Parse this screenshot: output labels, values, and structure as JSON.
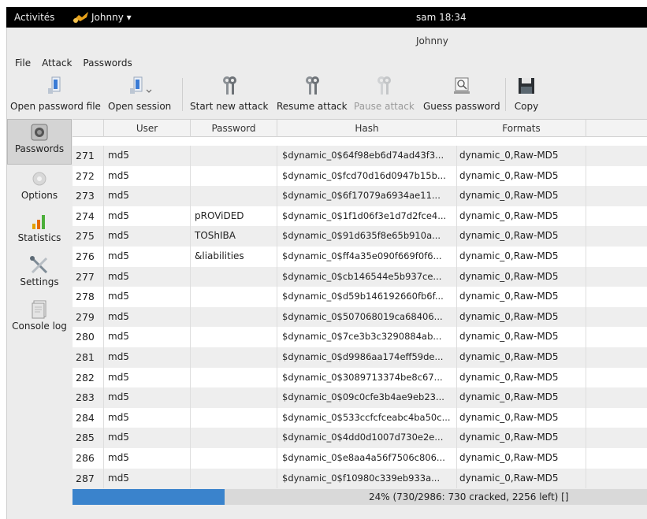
{
  "topbar": {
    "activities": "Activités",
    "user": "Johnny ▾",
    "clock": "sam 18:34"
  },
  "window": {
    "title": "Johnny"
  },
  "menu": {
    "file": "File",
    "attack": "Attack",
    "passwords": "Passwords"
  },
  "toolbar": {
    "open_password_file": "Open password file",
    "open_session": "Open session",
    "start_new_attack": "Start new attack",
    "resume_attack": "Resume attack",
    "pause_attack": "Pause attack",
    "guess_password": "Guess password",
    "copy": "Copy"
  },
  "sidebar": {
    "passwords": "Passwords",
    "options": "Options",
    "statistics": "Statistics",
    "settings": "Settings",
    "console_log": "Console log"
  },
  "table": {
    "headers": {
      "user": "User",
      "password": "Password",
      "hash": "Hash",
      "formats": "Formats"
    },
    "rows": [
      {
        "num": "271",
        "user": "md5",
        "password": "",
        "hash": "$dynamic_0$64f98eb6d74ad43f3...",
        "format": "dynamic_0,Raw-MD5"
      },
      {
        "num": "272",
        "user": "md5",
        "password": "",
        "hash": "$dynamic_0$fcd70d16d0947b15b...",
        "format": "dynamic_0,Raw-MD5"
      },
      {
        "num": "273",
        "user": "md5",
        "password": "",
        "hash": "$dynamic_0$6f17079a6934ae11...",
        "format": "dynamic_0,Raw-MD5"
      },
      {
        "num": "274",
        "user": "md5",
        "password": "pROViDED",
        "hash": "$dynamic_0$1f1d06f3e1d7d2fce4...",
        "format": "dynamic_0,Raw-MD5"
      },
      {
        "num": "275",
        "user": "md5",
        "password": "TOShIBA",
        "hash": "$dynamic_0$91d635f8e65b910a...",
        "format": "dynamic_0,Raw-MD5"
      },
      {
        "num": "276",
        "user": "md5",
        "password": "&liabilities",
        "hash": "$dynamic_0$ff4a35e090f669f0f6...",
        "format": "dynamic_0,Raw-MD5"
      },
      {
        "num": "277",
        "user": "md5",
        "password": "",
        "hash": "$dynamic_0$cb146544e5b937ce...",
        "format": "dynamic_0,Raw-MD5"
      },
      {
        "num": "278",
        "user": "md5",
        "password": "",
        "hash": "$dynamic_0$d59b146192660fb6f...",
        "format": "dynamic_0,Raw-MD5"
      },
      {
        "num": "279",
        "user": "md5",
        "password": "",
        "hash": "$dynamic_0$507068019ca68406...",
        "format": "dynamic_0,Raw-MD5"
      },
      {
        "num": "280",
        "user": "md5",
        "password": "",
        "hash": "$dynamic_0$7ce3b3c3290884ab...",
        "format": "dynamic_0,Raw-MD5"
      },
      {
        "num": "281",
        "user": "md5",
        "password": "",
        "hash": "$dynamic_0$d9986aa174eff59de...",
        "format": "dynamic_0,Raw-MD5"
      },
      {
        "num": "282",
        "user": "md5",
        "password": "",
        "hash": "$dynamic_0$3089713374be8c67...",
        "format": "dynamic_0,Raw-MD5"
      },
      {
        "num": "283",
        "user": "md5",
        "password": "",
        "hash": "$dynamic_0$09c0cfe3b4ae9eb23...",
        "format": "dynamic_0,Raw-MD5"
      },
      {
        "num": "284",
        "user": "md5",
        "password": "",
        "hash": "$dynamic_0$533ccfcfceabc4ba50c...",
        "format": "dynamic_0,Raw-MD5"
      },
      {
        "num": "285",
        "user": "md5",
        "password": "",
        "hash": "$dynamic_0$4dd0d1007d730e2e...",
        "format": "dynamic_0,Raw-MD5"
      },
      {
        "num": "286",
        "user": "md5",
        "password": "",
        "hash": "$dynamic_0$e8aa4a56f7506c806...",
        "format": "dynamic_0,Raw-MD5"
      },
      {
        "num": "287",
        "user": "md5",
        "password": "",
        "hash": "$dynamic_0$f10980c339eb933a...",
        "format": "dynamic_0,Raw-MD5"
      }
    ]
  },
  "status": {
    "text": "24% (730/2986: 730 cracked, 2256 left) []",
    "progress": 0.24
  },
  "colors": {
    "progress": "#3a83cc",
    "topbar": "#000000",
    "alt_row": "#eeeeee"
  }
}
